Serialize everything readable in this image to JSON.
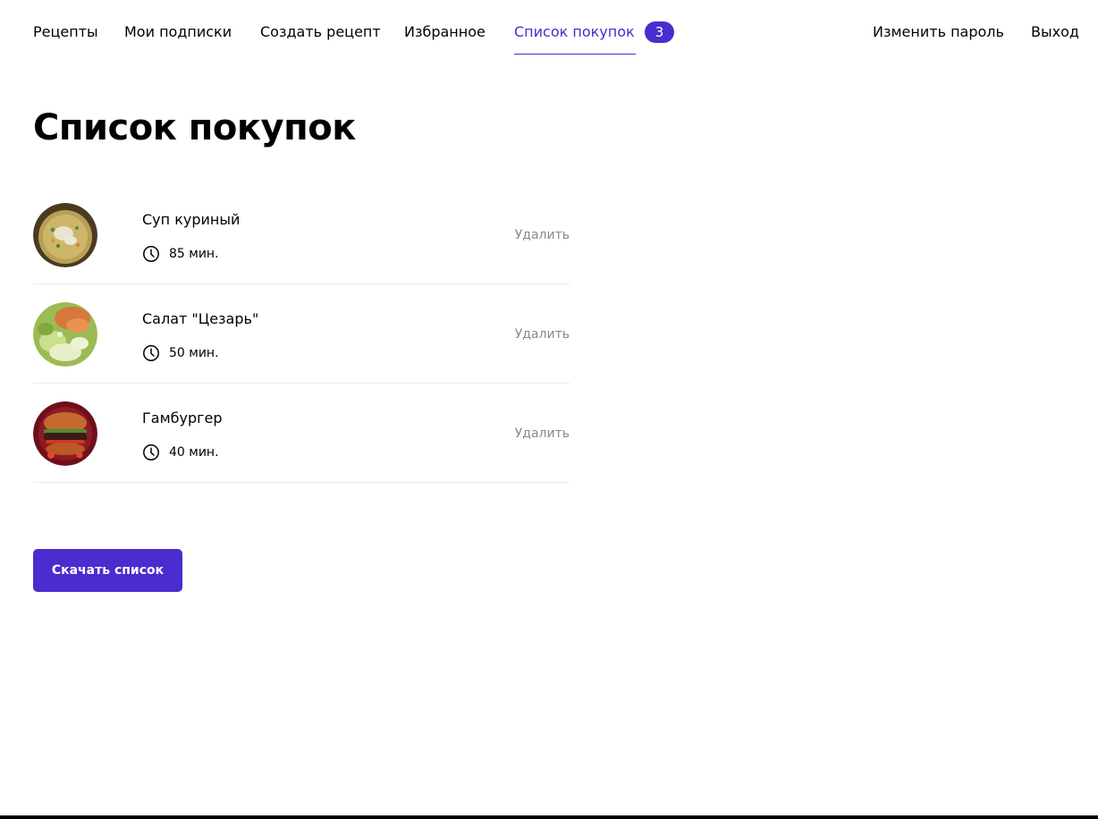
{
  "nav": {
    "recipes": "Рецепты",
    "subscriptions": "Мои подписки",
    "create_recipe": "Создать рецепт",
    "favorites": "Избранное",
    "shopping_list": "Список покупок",
    "shopping_count": "3",
    "change_password": "Изменить пароль",
    "logout": "Выход"
  },
  "page": {
    "title": "Список покупок"
  },
  "items": [
    {
      "title": "Суп куриный",
      "time": "85 мин.",
      "delete_label": "Удалить",
      "image": "chicken-soup-photo"
    },
    {
      "title": "Салат \"Цезарь\"",
      "time": "50 мин.",
      "delete_label": "Удалить",
      "image": "caesar-salad-photo"
    },
    {
      "title": "Гамбургер",
      "time": "40 мин.",
      "delete_label": "Удалить",
      "image": "hamburger-photo"
    }
  ],
  "download_label": "Скачать список",
  "colors": {
    "accent": "#4a2ccf",
    "muted": "#8a8a8a",
    "divider": "#ececec"
  }
}
